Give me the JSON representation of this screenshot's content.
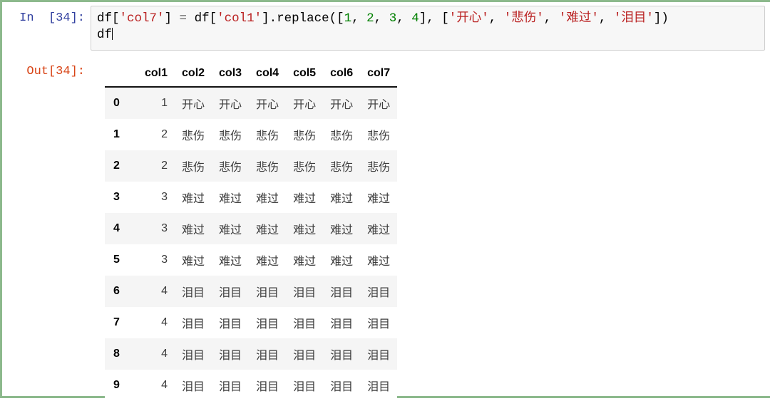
{
  "cell": {
    "in_prompt": "In  [34]:",
    "out_prompt": "Out[34]:",
    "accent_selected_border": "#8cb98c",
    "input_bg": "#f7f7f7",
    "input_border": "#cfcfcf",
    "in_prompt_color": "#303f9f",
    "out_prompt_color": "#d84315",
    "string_color": "#ba2121",
    "number_color": "#008000",
    "code": {
      "line1": {
        "p1": "df[",
        "s1": "'col7'",
        "p2": "] ",
        "op1": "=",
        "p3": " df[",
        "s2": "'col1'",
        "p4": "].replace([",
        "n1": "1",
        "p5": ", ",
        "n2": "2",
        "p6": ", ",
        "n3": "3",
        "p7": ", ",
        "n4": "4",
        "p8": "], [",
        "s3": "'开心'",
        "p9": ", ",
        "s4": "'悲伤'",
        "p10": ", ",
        "s5": "'难过'",
        "p11": ", ",
        "s6": "'泪目'",
        "p12": "])"
      },
      "line2": "df",
      "full_text": "df['col7'] = df['col1'].replace([1, 2, 3, 4], ['开心', '悲伤', '难过', '泪目'])\ndf"
    }
  },
  "dataframe": {
    "index_header": "",
    "columns": [
      "col1",
      "col2",
      "col3",
      "col4",
      "col5",
      "col6",
      "col7"
    ],
    "index": [
      "0",
      "1",
      "2",
      "3",
      "4",
      "5",
      "6",
      "7",
      "8",
      "9"
    ],
    "rows": [
      [
        "1",
        "开心",
        "开心",
        "开心",
        "开心",
        "开心",
        "开心"
      ],
      [
        "2",
        "悲伤",
        "悲伤",
        "悲伤",
        "悲伤",
        "悲伤",
        "悲伤"
      ],
      [
        "2",
        "悲伤",
        "悲伤",
        "悲伤",
        "悲伤",
        "悲伤",
        "悲伤"
      ],
      [
        "3",
        "难过",
        "难过",
        "难过",
        "难过",
        "难过",
        "难过"
      ],
      [
        "3",
        "难过",
        "难过",
        "难过",
        "难过",
        "难过",
        "难过"
      ],
      [
        "3",
        "难过",
        "难过",
        "难过",
        "难过",
        "难过",
        "难过"
      ],
      [
        "4",
        "泪目",
        "泪目",
        "泪目",
        "泪目",
        "泪目",
        "泪目"
      ],
      [
        "4",
        "泪目",
        "泪目",
        "泪目",
        "泪目",
        "泪目",
        "泪目"
      ],
      [
        "4",
        "泪目",
        "泪目",
        "泪目",
        "泪目",
        "泪目",
        "泪目"
      ],
      [
        "4",
        "泪目",
        "泪目",
        "泪目",
        "泪目",
        "泪目",
        "泪目"
      ]
    ]
  }
}
